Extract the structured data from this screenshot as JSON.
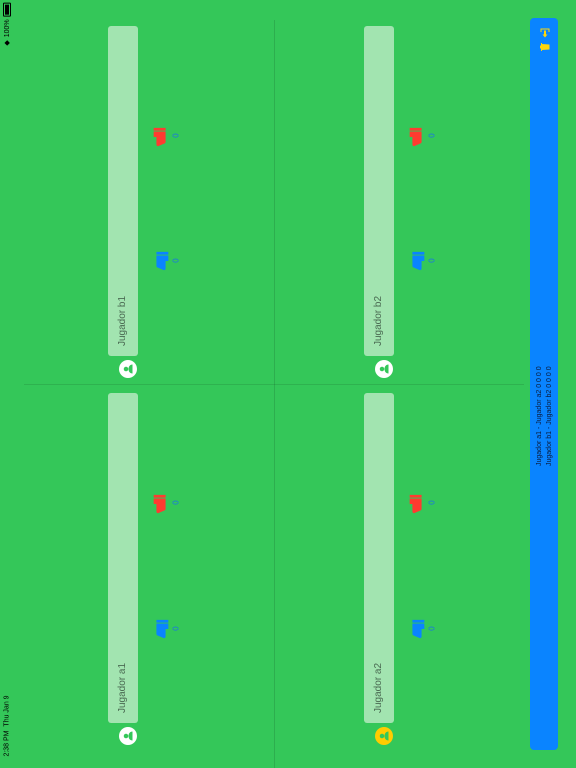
{
  "status_bar": {
    "time": "2:38 PM",
    "date": "Thu Jan 9",
    "battery": "100%"
  },
  "players": [
    {
      "name": "Jugador b1",
      "likes": "0",
      "dislikes": "0",
      "selected": false
    },
    {
      "name": "Jugador a1",
      "likes": "0",
      "dislikes": "0",
      "selected": false
    },
    {
      "name": "Jugador b2",
      "likes": "0",
      "dislikes": "0",
      "selected": false
    },
    {
      "name": "Jugador a2",
      "likes": "0",
      "dislikes": "0",
      "selected": true
    }
  ],
  "scoreboard": {
    "line1": "Jugador a1 - Jugador a2   0  0  0  0",
    "line2": "Jugador b1 - Jugador b2   0  0  0  0",
    "icons": [
      "exit-icon",
      "trash-icon"
    ]
  },
  "colors": {
    "background": "#34c759",
    "bar": "#a2e4b0",
    "scoreboard": "#0a84ff",
    "like": "#0a84ff",
    "dislike": "#ff3b30",
    "selected_avatar": "#ffcc00"
  }
}
